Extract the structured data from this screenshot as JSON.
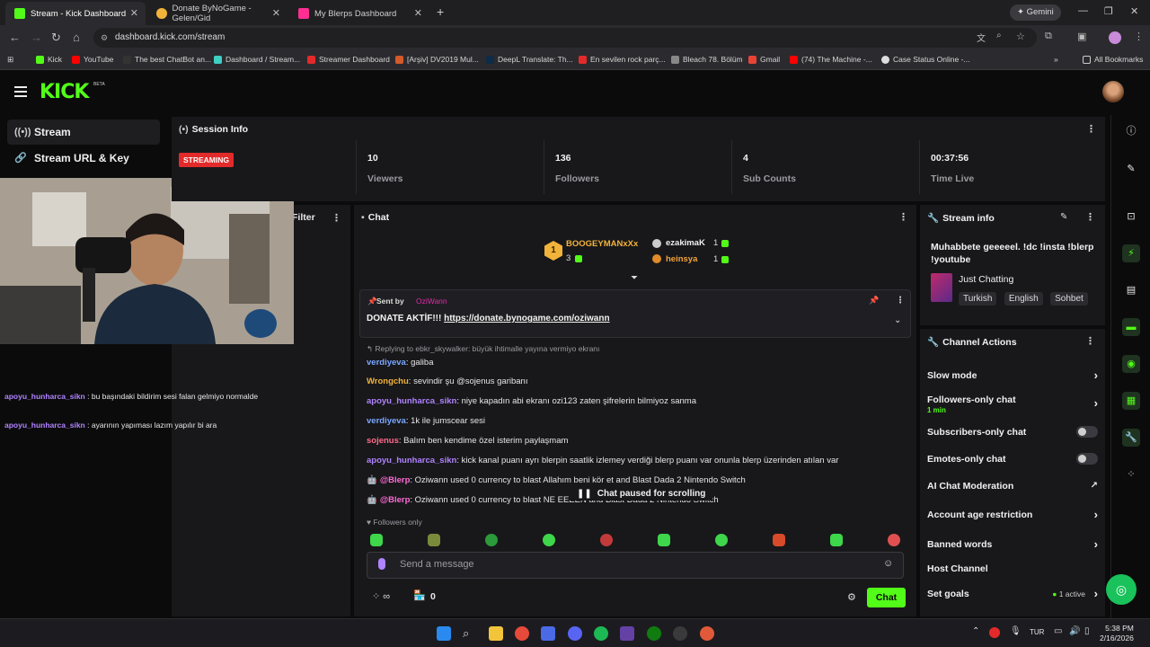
{
  "browser": {
    "tabs": [
      {
        "label": "Stream - Kick Dashboard",
        "color": "#53fc18"
      },
      {
        "label": "Donate ByNoGame - Gelen/Gid",
        "color": "#f2b33a"
      },
      {
        "label": "My Blerps Dashboard",
        "color": "#ff2e93"
      }
    ],
    "gemini_label": "Gemini",
    "url": "dashboard.kick.com/stream",
    "bookmarks": [
      "Kick",
      "YouTube",
      "The best ChatBot an...",
      "Dashboard / Stream...",
      "Streamer Dashboard",
      "[Arşiv] DV2019 Mul...",
      "DeepL Translate: Th...",
      "En sevilen rock parç...",
      "Bleach 78. Bölüm",
      "Gmail",
      "(74) The Machine -...",
      "Case Status Online -..."
    ],
    "all_bookmarks": "All Bookmarks"
  },
  "kick": {
    "logo": "KICK",
    "beta": "BETA",
    "nav": [
      {
        "label": "Stream"
      },
      {
        "label": "Stream URL & Key"
      }
    ]
  },
  "left_chat": [
    {
      "user": "apoyu_hunharca_sikn",
      "text": ": bu başındaki bildirim sesi falan gelmiyo normalde"
    },
    {
      "user": "apoyu_hunharca_sikn",
      "text": ": ayarının yapıması lazım yapılır bi ara"
    }
  ],
  "session": {
    "title": "Session Info",
    "badge": "STREAMING",
    "stats": [
      {
        "value": "10",
        "label": "Viewers"
      },
      {
        "value": "136",
        "label": "Followers"
      },
      {
        "value": "4",
        "label": "Sub Counts"
      },
      {
        "value": "00:37:56",
        "label": "Time Live"
      }
    ]
  },
  "filter_label": "Filter",
  "chat": {
    "title": "Chat",
    "leaderboard": [
      {
        "name": "BOOGEYMANxXx",
        "count": "3",
        "color": "#f2b33a"
      },
      {
        "name": "ezakimaK",
        "count": "1",
        "color": "#e8e8e8"
      },
      {
        "name": "heinsya",
        "count": "1",
        "color": "#f2a33a"
      }
    ],
    "pinned": {
      "sent_by_label": "Sent by",
      "sender": "OziWann",
      "text_prefix": "DONATE AKTİF!!! ",
      "link": "https://donate.bynogame.com/oziwann"
    },
    "reply_hint": "Replying to ebkr_skywalker: büyük ihtimalle yayına vermiyo ekranı",
    "messages": [
      {
        "user": "verdiyeva",
        "text": ": galiba",
        "color": "#7aa7ff"
      },
      {
        "user": "Wrongchu",
        "text": ": sevindir şu @sojenus garibanı",
        "color": "#f2b33a"
      },
      {
        "user": "apoyu_hunharca_sikn",
        "text": ": niye kapadın abi ekranı ozi123 zaten şifrelerin bilmiyoz sanma",
        "color": "#b083ff"
      },
      {
        "user": "verdiyeva",
        "text": ": 1k ile jumscear sesi",
        "color": "#7aa7ff"
      },
      {
        "user": "sojenus",
        "text": ": Balım ben kendime özel isterim paylaşmam",
        "color": "#ff6b8a"
      },
      {
        "user": "apoyu_hunharca_sikn",
        "text": ": kick kanal puanı ayrı blerpin saatlik izlemey verdiği blerp puanı var onunla blerp üzerinden atılan var",
        "color": "#b083ff"
      },
      {
        "user": "@Blerp",
        "text": ": Oziwann used 0 currency to blast Allahım beni kör et and Blast Dada 2 Nintendo Switch",
        "color": "#ff6bd6"
      },
      {
        "user": "@Blerp",
        "text": ": Oziwann used 0 currency to blast NE          EEEEN and Blast Dada 2 Nintendo Switch",
        "color": "#ff6bd6"
      }
    ],
    "paused": "Chat paused for scrolling",
    "followers_only": "Followers only",
    "placeholder": "Send a message",
    "store_count": "0",
    "chat_button": "Chat"
  },
  "stream_info": {
    "title": "Stream info",
    "stream_title": "Muhabbete geeeeel. !dc !insta !blerp !youtube",
    "category": "Just Chatting",
    "tags": [
      "Turkish",
      "English",
      "Sohbet"
    ]
  },
  "channel_actions": {
    "title": "Channel Actions",
    "items": [
      {
        "label": "Slow mode",
        "kind": "chevron"
      },
      {
        "label": "Followers-only chat",
        "sub": "1 min",
        "kind": "chevron"
      },
      {
        "label": "Subscribers-only chat",
        "kind": "toggle"
      },
      {
        "label": "Emotes-only chat",
        "kind": "toggle"
      },
      {
        "label": "AI Chat Moderation",
        "kind": "external"
      },
      {
        "label": "Account age restriction",
        "kind": "chevron"
      },
      {
        "label": "Banned words",
        "kind": "chevron"
      },
      {
        "label": "Host Channel",
        "kind": "none"
      },
      {
        "label": "Set goals",
        "sub_right": "1 active",
        "kind": "chevron"
      }
    ]
  },
  "taskbar": {
    "lang": "TUR",
    "time": "5:38 PM",
    "date": "2/16/2026"
  }
}
